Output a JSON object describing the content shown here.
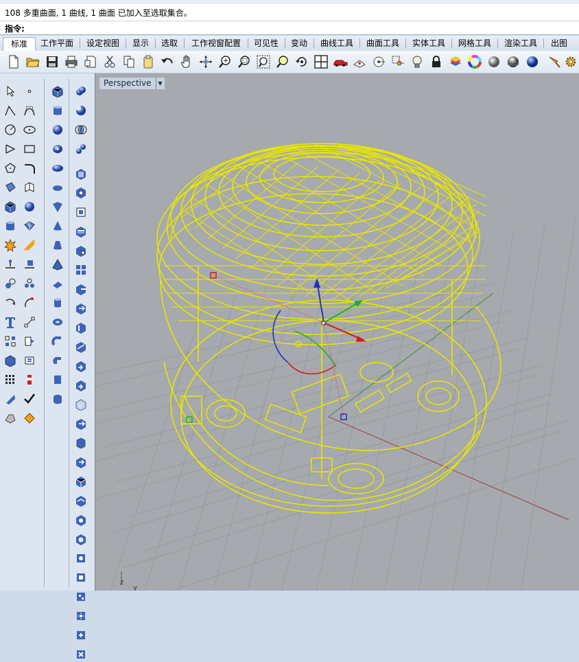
{
  "history_line": "108 多重曲面, 1 曲线, 1 曲面 已加入至选取集合。",
  "command": {
    "label": "指令:",
    "value": ""
  },
  "tabs": [
    "标准",
    "工作平面",
    "设定视图",
    "显示",
    "选取",
    "工作视窗配置",
    "可见性",
    "变动",
    "曲线工具",
    "曲面工具",
    "实体工具",
    "网格工具",
    "渲染工具",
    "出图"
  ],
  "toolbar_icons": [
    "new-file-icon",
    "open-folder-icon",
    "save-icon",
    "print-icon",
    "import-icon",
    "cut-icon",
    "copy-icon",
    "paste-icon",
    "undo-icon",
    "pan-hand-icon",
    "rotate-view-icon",
    "zoom-in-icon",
    "zoom-window-icon",
    "zoom-extents-icon",
    "zoom-selected-icon",
    "rotate-camera-icon",
    "four-viewports-icon",
    "car-icon",
    "grid-snap-icon",
    "circle-target-icon",
    "gumball-icon",
    "light-bulb-icon",
    "lock-icon",
    "layer-stack-icon",
    "color-wheel-icon",
    "shaded-sphere-icon",
    "rendered-sphere-icon",
    "blue-sphere-icon",
    "brush-icon",
    "gear-icon"
  ],
  "viewport": {
    "name": "Perspective",
    "axis_z": "z",
    "axis_y": "y"
  },
  "colors": {
    "selection": "#e8e600",
    "grid": "#8d9196",
    "x_axis": "#9c3b3b",
    "y_axis": "#3b8c3b"
  }
}
